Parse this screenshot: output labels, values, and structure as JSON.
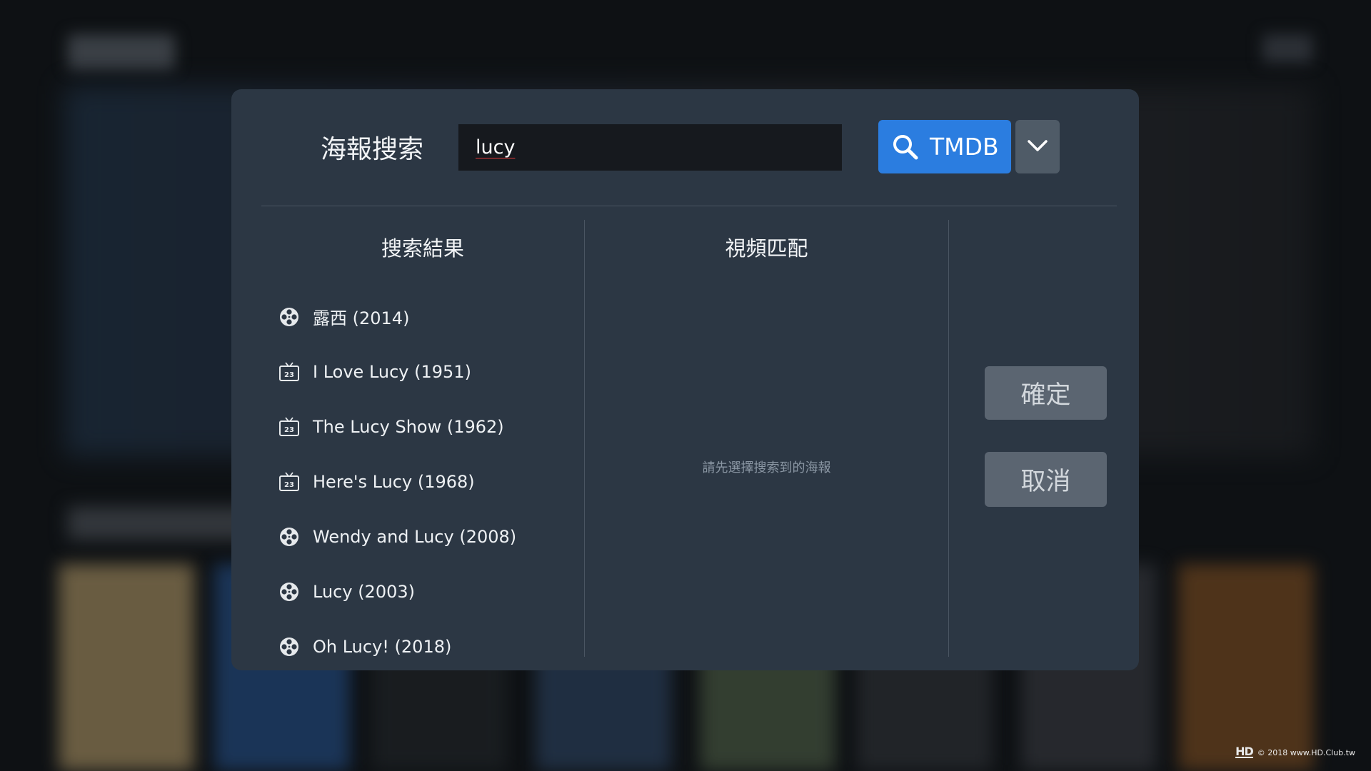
{
  "dialog": {
    "title": "海報搜索",
    "search_value": "lucy",
    "source_button_label": "TMDB",
    "results_heading": "搜索結果",
    "match_heading": "視頻匹配",
    "match_hint": "請先選擇搜索到的海報",
    "confirm_label": "確定",
    "cancel_label": "取消",
    "accent_color": "#2b7de0"
  },
  "results": [
    {
      "title": "露西 (2014)",
      "icon": "film-reel-icon"
    },
    {
      "title": "I Love Lucy (1951)",
      "icon": "tv-icon"
    },
    {
      "title": "The Lucy Show (1962)",
      "icon": "tv-icon"
    },
    {
      "title": "Here's Lucy (1968)",
      "icon": "tv-icon"
    },
    {
      "title": "Wendy and Lucy (2008)",
      "icon": "film-reel-icon"
    },
    {
      "title": "Lucy (2003)",
      "icon": "film-reel-icon"
    },
    {
      "title": "Oh Lucy! (2018)",
      "icon": "film-reel-icon"
    }
  ],
  "watermark": {
    "logo": "HD",
    "text": "© 2018 www.HD.Club.tw"
  }
}
